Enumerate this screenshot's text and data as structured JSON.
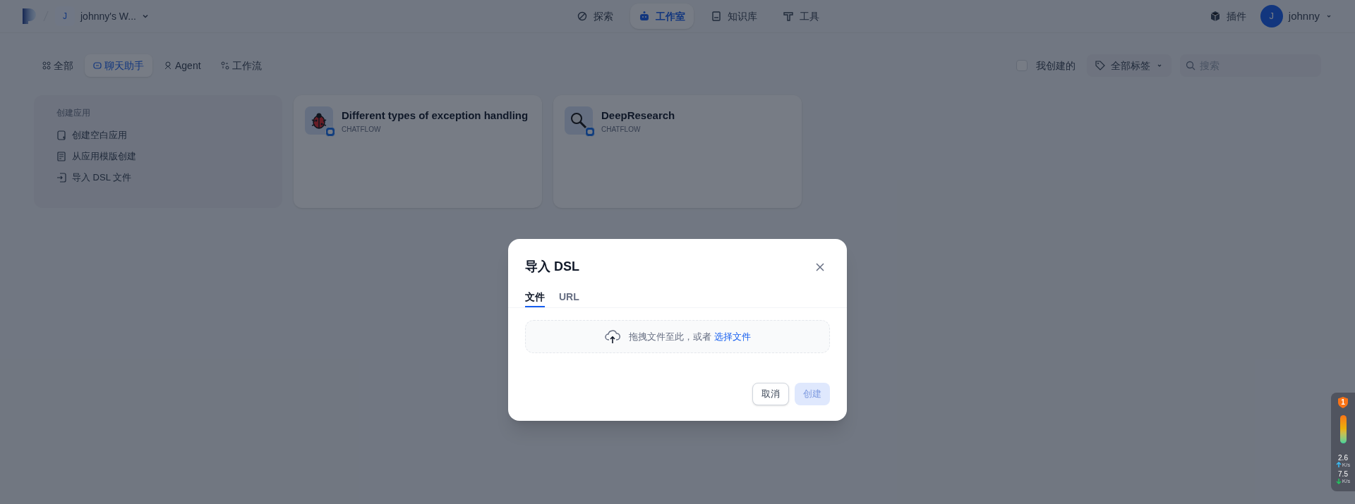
{
  "header": {
    "workspace": {
      "avatar": "J",
      "name": "johnny's W..."
    },
    "nav": [
      {
        "label": "探索",
        "selected": false
      },
      {
        "label": "工作室",
        "selected": true
      },
      {
        "label": "知识库",
        "selected": false
      },
      {
        "label": "工具",
        "selected": false
      }
    ],
    "plugins": "插件",
    "user": {
      "avatar": "J",
      "name": "johnny"
    }
  },
  "filters": {
    "tabs": [
      {
        "label": "全部",
        "selected": false
      },
      {
        "label": "聊天助手",
        "selected": true
      },
      {
        "label": "Agent",
        "selected": false
      },
      {
        "label": "工作流",
        "selected": false
      }
    ],
    "created_by_me": {
      "label": "我创建的",
      "checked": false
    },
    "tags": "全部标签",
    "search": {
      "placeholder": "搜索"
    }
  },
  "create_card": {
    "title": "创建应用",
    "actions": [
      "创建空白应用",
      "从应用模版创建",
      "导入 DSL 文件"
    ]
  },
  "apps": [
    {
      "name": "Different types of exception handling",
      "mode": "CHATFLOW"
    },
    {
      "name": "DeepResearch",
      "mode": "CHATFLOW"
    }
  ],
  "dialog": {
    "title": "导入 DSL",
    "tabs": [
      {
        "label": "文件",
        "selected": true
      },
      {
        "label": "URL",
        "selected": false
      }
    ],
    "dropzone": {
      "text": "拖拽文件至此，或者",
      "link": "选择文件"
    },
    "cancel": "取消",
    "create": {
      "label": "创建",
      "disabled": true
    }
  },
  "net_widget": {
    "badge": "1",
    "upload": {
      "value": "2.6",
      "unit": "K/s"
    },
    "download": {
      "value": "7.5",
      "unit": "K/s"
    }
  }
}
